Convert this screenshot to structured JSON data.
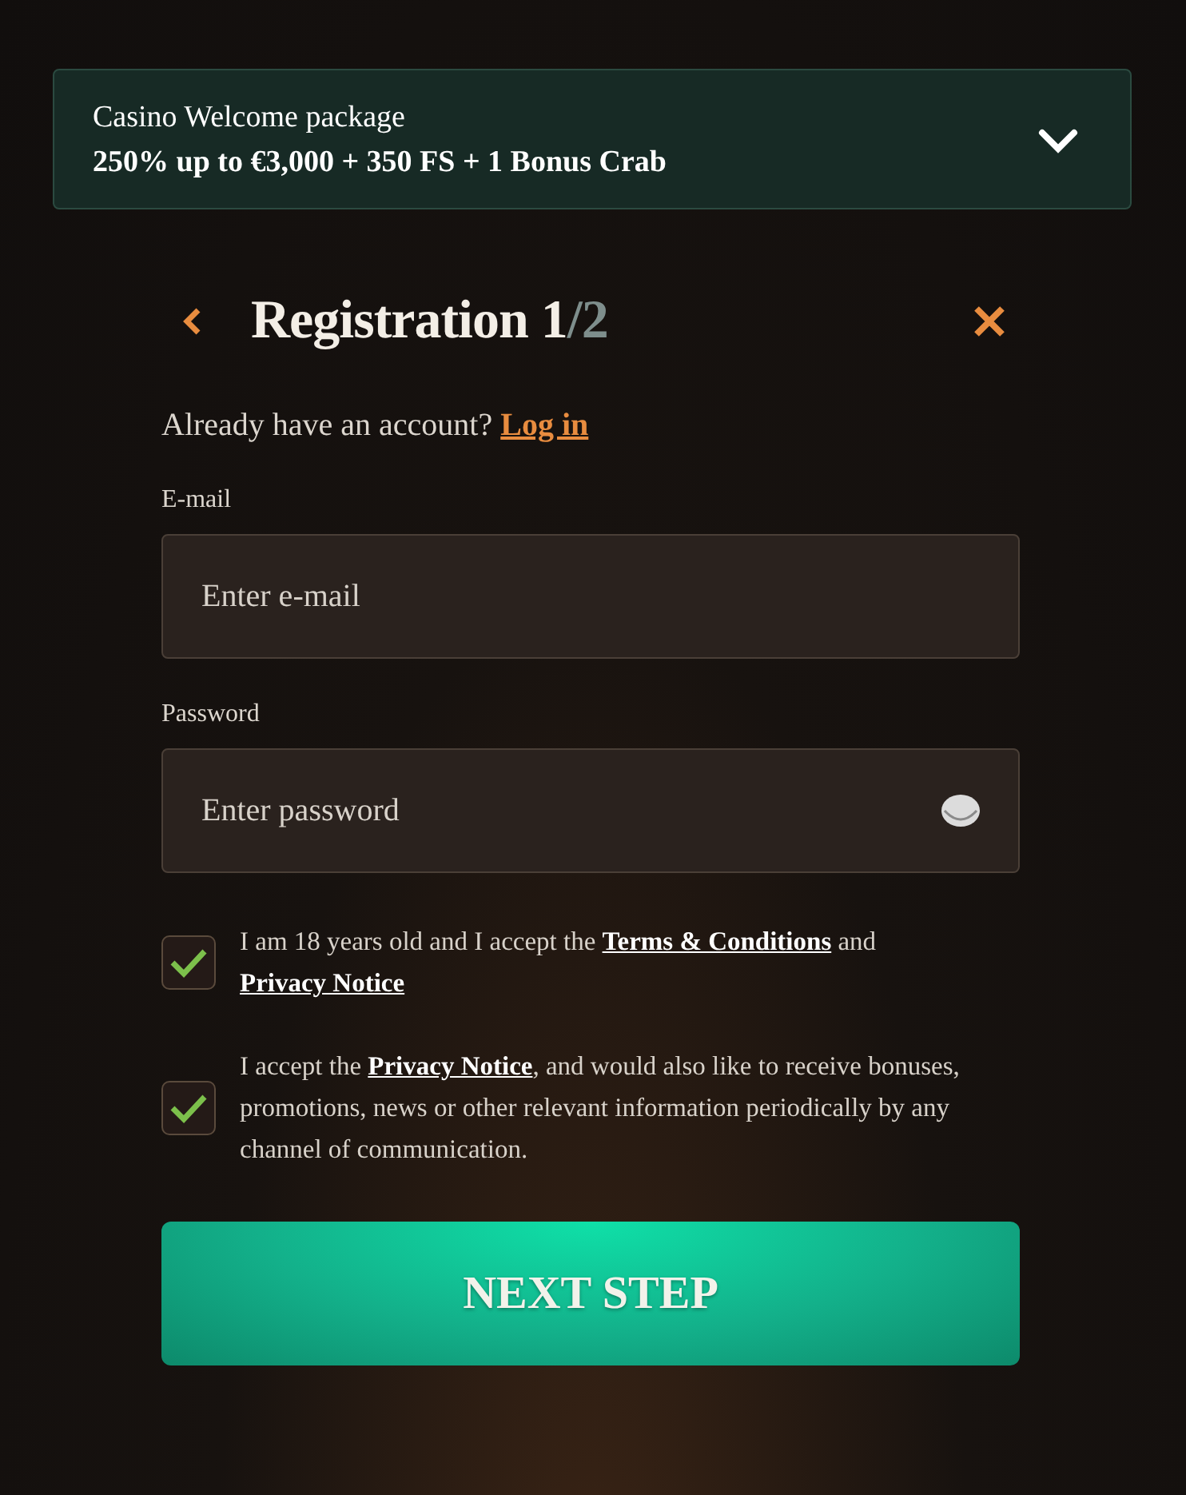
{
  "promo": {
    "title": "Casino Welcome package",
    "offer": "250% up to €3,000 + 350 FS + 1 Bonus Crab",
    "expanded": false
  },
  "header": {
    "title": "Registration 1",
    "step_suffix": "/2"
  },
  "login_prompt": {
    "text": "Already have an account?",
    "link": "Log in"
  },
  "fields": [
    {
      "label": "E-mail",
      "placeholder": "Enter e-mail",
      "kind": "email"
    },
    {
      "label": "Password",
      "placeholder": "Enter password",
      "kind": "password"
    }
  ],
  "consents": [
    {
      "checked": true,
      "parts": [
        {
          "text": "I am 18 years old and I accept the "
        },
        {
          "link": "Terms & Conditions"
        },
        {
          "text": " and "
        },
        {
          "link": "Privacy Notice"
        }
      ]
    },
    {
      "checked": true,
      "parts": [
        {
          "text": "I accept the "
        },
        {
          "link": "Privacy Notice"
        },
        {
          "text": ", and would also like to receive bonuses, promotions, news or other relevant information periodically by any channel of communication."
        }
      ]
    }
  ],
  "submit": "NEXT STEP"
}
